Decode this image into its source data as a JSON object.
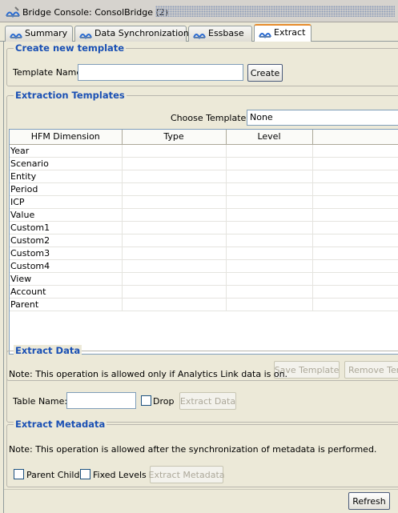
{
  "window": {
    "title": "Bridge Console: ConsolBridge (2)"
  },
  "tabs": [
    {
      "label": "Summary"
    },
    {
      "label": "Data Synchronization"
    },
    {
      "label": "Essbase"
    },
    {
      "label": "Extract"
    }
  ],
  "create_template": {
    "group_title": "Create new template",
    "name_label": "Template Name:",
    "name_value": "",
    "create_button": "Create"
  },
  "extraction_templates": {
    "group_title": "Extraction Templates",
    "choose_label": "Choose Template:",
    "choose_value": "None",
    "columns": [
      "HFM Dimension",
      "Type",
      "Level",
      ""
    ],
    "rows": [
      [
        "Year",
        "",
        "",
        ""
      ],
      [
        "Scenario",
        "",
        "",
        ""
      ],
      [
        "Entity",
        "",
        "",
        ""
      ],
      [
        "Period",
        "",
        "",
        ""
      ],
      [
        "ICP",
        "",
        "",
        ""
      ],
      [
        "Value",
        "",
        "",
        ""
      ],
      [
        "Custom1",
        "",
        "",
        ""
      ],
      [
        "Custom2",
        "",
        "",
        ""
      ],
      [
        "Custom3",
        "",
        "",
        ""
      ],
      [
        "Custom4",
        "",
        "",
        ""
      ],
      [
        "View",
        "",
        "",
        ""
      ],
      [
        "Account",
        "",
        "",
        ""
      ],
      [
        "Parent",
        "",
        "",
        ""
      ]
    ],
    "save_button": "Save Template",
    "remove_button": "Remove Tem"
  },
  "extract_data": {
    "group_title": "Extract Data",
    "note": "Note: This operation is allowed only if Analytics Link data is on.",
    "table_name_label": "Table Name:",
    "table_name_value": "",
    "drop_label": "Drop",
    "drop_checked": false,
    "extract_button": "Extract Data"
  },
  "extract_metadata": {
    "group_title": "Extract Metadata",
    "note": "Note: This operation is allowed after the synchronization of metadata is performed.",
    "parent_child_label": "Parent Child",
    "parent_child_checked": false,
    "fixed_levels_label": "Fixed Levels",
    "fixed_levels_checked": false,
    "extract_button": "Extract Metadata"
  },
  "footer": {
    "refresh_button": "Refresh"
  },
  "icons": {
    "window": "bridge-icon",
    "tab": "bridge-icon"
  }
}
